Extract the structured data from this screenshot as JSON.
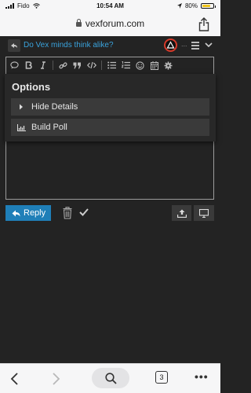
{
  "status_bar": {
    "carrier": "Fido",
    "time": "10:54 AM",
    "battery": "80%",
    "battery_level": 0.8
  },
  "url_bar": {
    "domain": "vexforum.com"
  },
  "composer": {
    "topic_title": "Do Vex minds think alike?",
    "overflow": "...",
    "toolbar_icons": [
      "speech-bubble-icon",
      "bold-icon",
      "italic-icon",
      "link-icon",
      "quote-icon",
      "code-icon",
      "bullet-list-icon",
      "numbered-list-icon",
      "emoji-icon",
      "calendar-icon",
      "gear-icon"
    ]
  },
  "options_menu": {
    "title": "Options",
    "items": [
      {
        "label": "Hide Details",
        "icon": "caret-right-icon"
      },
      {
        "label": "Build Poll",
        "icon": "bar-chart-icon"
      }
    ]
  },
  "actions": {
    "reply_label": "Reply"
  },
  "safari_bar": {
    "tab_count": "3",
    "more": "•••"
  },
  "colors": {
    "accent": "#1f7fb8",
    "link": "#3aa3dd",
    "background": "#232323"
  }
}
